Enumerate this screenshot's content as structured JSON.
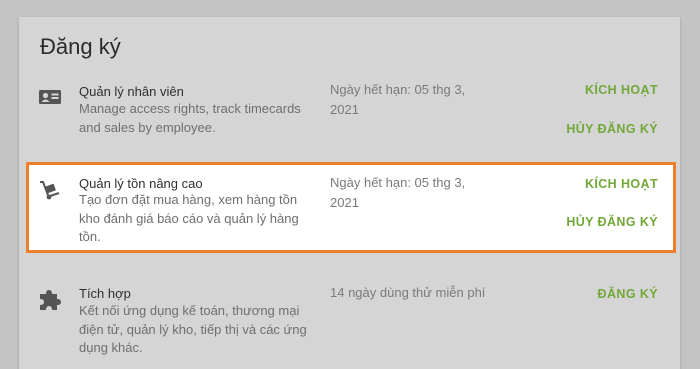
{
  "page": {
    "title": "Đăng ký"
  },
  "subscriptions": [
    {
      "name": "Quản lý nhân viên",
      "description": "Manage access rights, track timecards and sales by employee.",
      "expiry": "Ngày hết hạn: 05 thg 3, 2021",
      "primary_action": "KÍCH HOẠT",
      "secondary_action": "HỦY ĐĂNG KÝ",
      "icon": "id-card-icon"
    },
    {
      "name": "Quản lý tồn nâng cao",
      "description": "Tạo đơn đặt mua hàng, xem hàng tồn kho đánh giá báo cáo và quản lý hàng tồn.",
      "expiry": "Ngày hết hạn: 05 thg 3, 2021",
      "primary_action": "KÍCH HOẠT",
      "secondary_action": "HỦY ĐĂNG KÝ",
      "icon": "hand-truck-icon",
      "highlighted": true
    },
    {
      "name": "Tích hợp",
      "description": "Kết nối ứng dụng kế toán, thương mại điện tử, quản lý kho, tiếp thị và các ứng dụng khác.",
      "expiry": "14 ngày dùng thử miễn phí",
      "primary_action": "ĐĂNG KÝ",
      "icon": "puzzle-piece-icon"
    }
  ],
  "colors": {
    "accent": "#72a83a",
    "highlight_border": "#ee7f2d",
    "backdrop": "#c4c4c4",
    "card": "#d5d5d5"
  }
}
